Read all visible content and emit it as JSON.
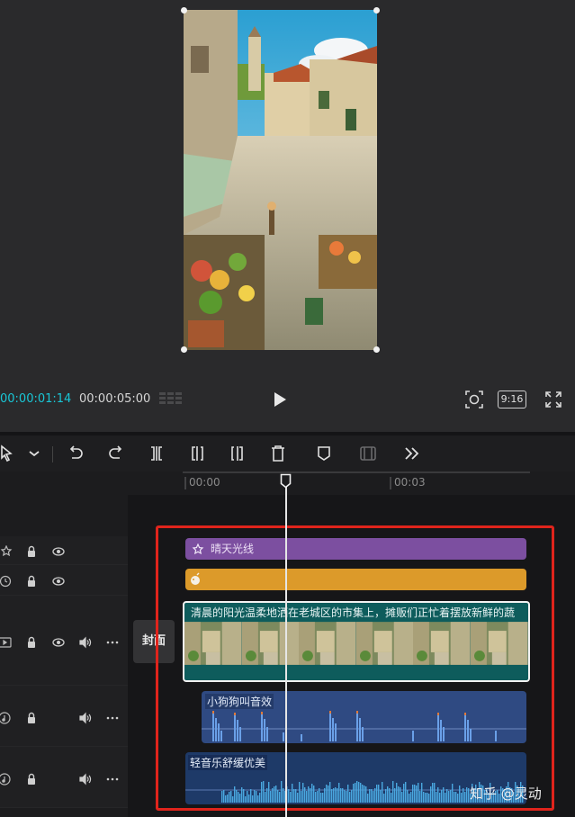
{
  "player": {
    "current_time": "00:00:01:14",
    "total_time": "00:00:05:00",
    "aspect_ratio": "9:16"
  },
  "toolbar": {
    "tools": [
      "select-tool",
      "undo",
      "redo",
      "split",
      "trim-left",
      "trim-right",
      "delete",
      "marker",
      "freeze-frame",
      "more"
    ]
  },
  "ruler": {
    "ticks": [
      "00:00",
      "00:03"
    ]
  },
  "cover_label": "封面",
  "tracks": {
    "effect": {
      "label": "晴天光线",
      "color": "#7c4fa0"
    },
    "filter": {
      "label": "",
      "color": "#dc9a2a"
    },
    "video": {
      "label": "清晨的阳光温柔地洒在老城区的市集上，摊贩们正忙着摆放新鲜的蔬",
      "color": "#0e5c5c"
    },
    "sfx": {
      "label": "小狗狗叫音效",
      "color": "#2f4a82"
    },
    "music": {
      "label": "轻音乐舒缓优美",
      "color": "#1e3a68"
    }
  },
  "watermark": "知乎 @灵动"
}
